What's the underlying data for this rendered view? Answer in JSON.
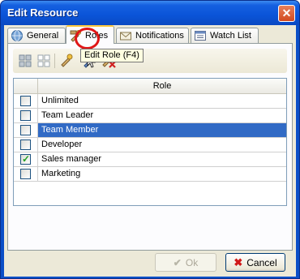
{
  "window": {
    "title": "Edit Resource"
  },
  "tabs": [
    {
      "label": "General"
    },
    {
      "label": "Roles"
    },
    {
      "label": "Notifications"
    },
    {
      "label": "Watch List"
    }
  ],
  "tooltip": {
    "text": "Edit Role (F4)"
  },
  "grid": {
    "header": "Role",
    "rows": [
      {
        "label": "Unlimited",
        "checked": false,
        "selected": false
      },
      {
        "label": "Team Leader",
        "checked": false,
        "selected": false
      },
      {
        "label": "Team Member",
        "checked": false,
        "selected": true
      },
      {
        "label": "Developer",
        "checked": false,
        "selected": false
      },
      {
        "label": "Sales manager",
        "checked": true,
        "selected": false
      },
      {
        "label": "Marketing",
        "checked": false,
        "selected": false
      }
    ]
  },
  "buttons": {
    "ok": "Ok",
    "cancel": "Cancel"
  },
  "colors": {
    "title_bar": "#0a54d8",
    "selection": "#316ac5",
    "highlight_ring": "#e01616"
  }
}
